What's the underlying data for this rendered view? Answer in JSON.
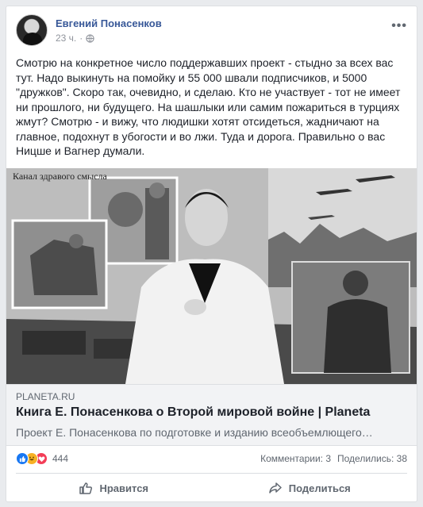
{
  "post": {
    "author": "Евгений Понасенков",
    "time": "23 ч.",
    "privacy_icon": "globe-icon",
    "more_icon": "more-icon",
    "text": "Смотрю на конкретное число поддержавших проект - стыдно за всех вас тут. Надо выкинуть на помойку и 55 000 швали подписчиков, и 5000 \"дружков\". Скоро так, очевидно, и сделаю. Кто не участвует - тот не имеет ни прошлого, ни будущего. На шашлыки или самим пожариться в турциях жмут? Смотрю - и вижу, что людишки хотят отсидеться, жадничают на главное, подохнут в убогости и во лжи. Туда и дорога. Правильно о вас Ницше и Вагнер думали."
  },
  "link": {
    "image_caption": "Канал здравого смысла",
    "domain": "PLANETA.RU",
    "title": "Книга Е. Понасенкова о Второй мировой войне | Planeta",
    "description": "Проект Е. Понасенкова по подготовке и изданию всеобъемлющего…"
  },
  "stats": {
    "reactions": [
      "like-icon",
      "haha-icon",
      "love-icon"
    ],
    "reaction_count": "444",
    "comments": "Комментарии: 3",
    "shares": "Поделились: 38"
  },
  "actions": {
    "like_label": "Нравится",
    "share_label": "Поделиться"
  },
  "colors": {
    "author_link": "#385898",
    "background": "#e9ebee",
    "link_bg": "#f2f3f5",
    "like_blue": "#1877f2"
  }
}
